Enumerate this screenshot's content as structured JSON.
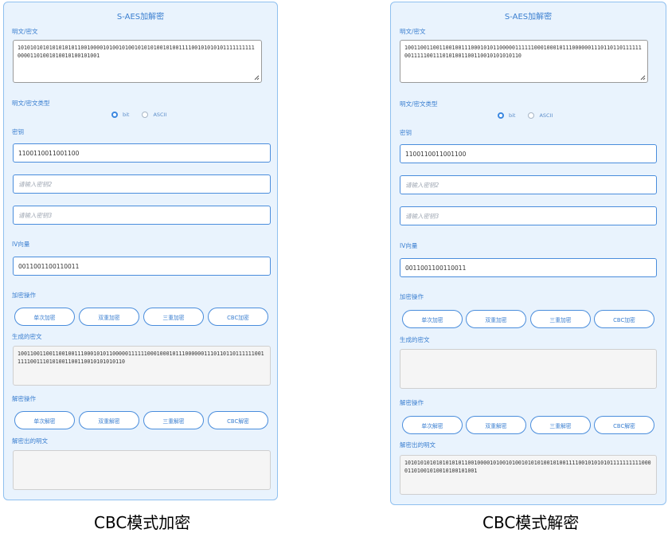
{
  "panels": [
    {
      "title": "S-AES加解密",
      "plaintext_label": "明文/密文",
      "plaintext_value": "10101010101010101011001000010100101001010101001010011110010101010111111111100001101001010010100101001",
      "type_label": "明文/密文类型",
      "type_options": [
        "bit",
        "ASCII"
      ],
      "type_selected": "bit",
      "key_label": "密钥",
      "key1_value": "1100110011001100",
      "key2_placeholder": "请输入密钥2",
      "key3_placeholder": "请输入密钥3",
      "iv_label": "IV向量",
      "iv_value": "0011001100110011",
      "encrypt_ops_label": "加密操作",
      "encrypt_buttons": [
        "单次加密",
        "双重加密",
        "三重加密",
        "CBC加密"
      ],
      "cipher_out_label": "生成的密文",
      "cipher_out_value": "1001100110011001001110001010110000011111100010001011100000011101101101111110011111001110101001100110010101010110",
      "decrypt_ops_label": "解密操作",
      "decrypt_buttons": [
        "单次解密",
        "双重解密",
        "三重解密",
        "CBC解密"
      ],
      "plain_out_label": "解密出的明文",
      "plain_out_value": ""
    },
    {
      "title": "S-AES加解密",
      "plaintext_label": "明文/密文",
      "plaintext_value": "1001100110011001001110001010110000011111100010001011100000011101101101111110011111001110101001100110010101010110",
      "type_label": "明文/密文类型",
      "type_options": [
        "bit",
        "ASCII"
      ],
      "type_selected": "bit",
      "key_label": "密钥",
      "key1_value": "1100110011001100",
      "key2_placeholder": "请输入密钥2",
      "key3_placeholder": "请输入密钥3",
      "iv_label": "IV向量",
      "iv_value": "0011001100110011",
      "encrypt_ops_label": "加密操作",
      "encrypt_buttons": [
        "单次加密",
        "双重加密",
        "三重加密",
        "CBC加密"
      ],
      "cipher_out_label": "生成的密文",
      "cipher_out_value": "",
      "decrypt_ops_label": "解密操作",
      "decrypt_buttons": [
        "单次解密",
        "双重解密",
        "三重解密",
        "CBC解密"
      ],
      "plain_out_label": "解密出的明文",
      "plain_out_value": "10101010101010101011001000010100101001010101001010011110010101010111111111100001101001010010100101001"
    }
  ],
  "captions": [
    "CBC模式加密",
    "CBC模式解密"
  ],
  "colors": {
    "accent": "#3b7fd0",
    "panel_bg": "#e9f3fd",
    "panel_border": "#8fc0ef"
  }
}
